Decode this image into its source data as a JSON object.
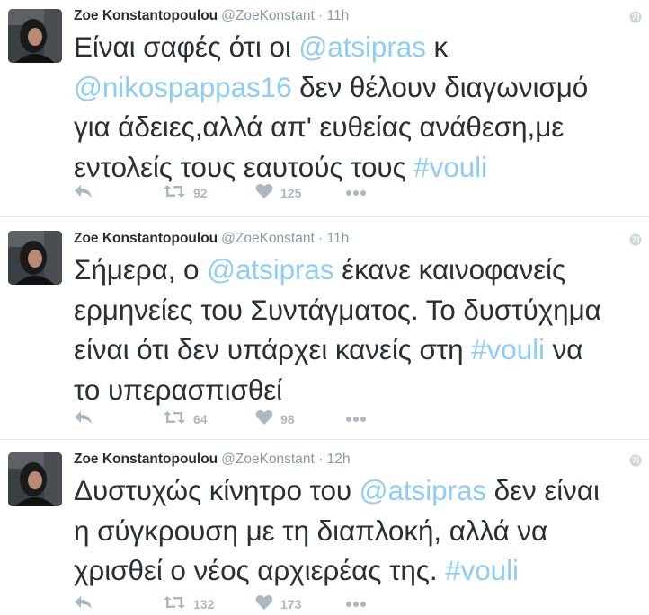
{
  "tweets": [
    {
      "name": "Zoe Konstantopoulou",
      "handle": "@ZoeKonstant",
      "separator": "·",
      "time": "11h",
      "lines": [
        [
          {
            "t": "Είναι σαφές ότι οι "
          },
          {
            "t": "@atsipras",
            "link": true
          },
          {
            "t": " κ"
          }
        ],
        [
          {
            "t": "@nikospappas16",
            "link": true
          },
          {
            "t": " δεν θέλουν διαγωνισμό"
          }
        ],
        [
          {
            "t": "για άδειες,αλλά απ' ευθείας ανάθεση,με"
          }
        ],
        [
          {
            "t": "εντολείς τους εαυτούς τους "
          },
          {
            "t": "#vouli",
            "link": true
          }
        ]
      ],
      "retweets": "92",
      "likes": "125"
    },
    {
      "name": "Zoe Konstantopoulou",
      "handle": "@ZoeKonstant",
      "separator": "·",
      "time": "11h",
      "lines": [
        [
          {
            "t": "Σήμερα, ο "
          },
          {
            "t": "@atsipras",
            "link": true
          },
          {
            "t": " έκανε καινοφανείς"
          }
        ],
        [
          {
            "t": "ερμηνείες του Συντάγματος. Το δυστύχημα"
          }
        ],
        [
          {
            "t": "είναι ότι δεν υπάρχει κανείς στη "
          },
          {
            "t": "#vouli",
            "link": true
          },
          {
            "t": " να"
          }
        ],
        [
          {
            "t": "το υπερασπισθεί"
          }
        ]
      ],
      "retweets": "64",
      "likes": "98"
    },
    {
      "name": "Zoe Konstantopoulou",
      "handle": "@ZoeKonstant",
      "separator": "·",
      "time": "12h",
      "lines": [
        [
          {
            "t": "Δυστυχώς κίνητρο του "
          },
          {
            "t": "@atsipras",
            "link": true
          },
          {
            "t": " δεν είναι"
          }
        ],
        [
          {
            "t": "η σύγκρουση με τη διαπλοκή, αλλά να"
          }
        ],
        [
          {
            "t": "χρισθεί ο νέος αρχιερέας της. "
          },
          {
            "t": "#vouli",
            "link": true
          }
        ]
      ],
      "retweets": "132",
      "likes": "173"
    }
  ],
  "icons": {
    "reply": "reply-icon",
    "retweet": "retweet-icon",
    "like": "heart-icon",
    "more": "more-icon",
    "globe": "globe-icon"
  },
  "colors": {
    "text": "#292f33",
    "muted": "#8899a6",
    "link": "#8ecdf8",
    "action": "#aab8c2",
    "divider": "#e1e8ed"
  }
}
